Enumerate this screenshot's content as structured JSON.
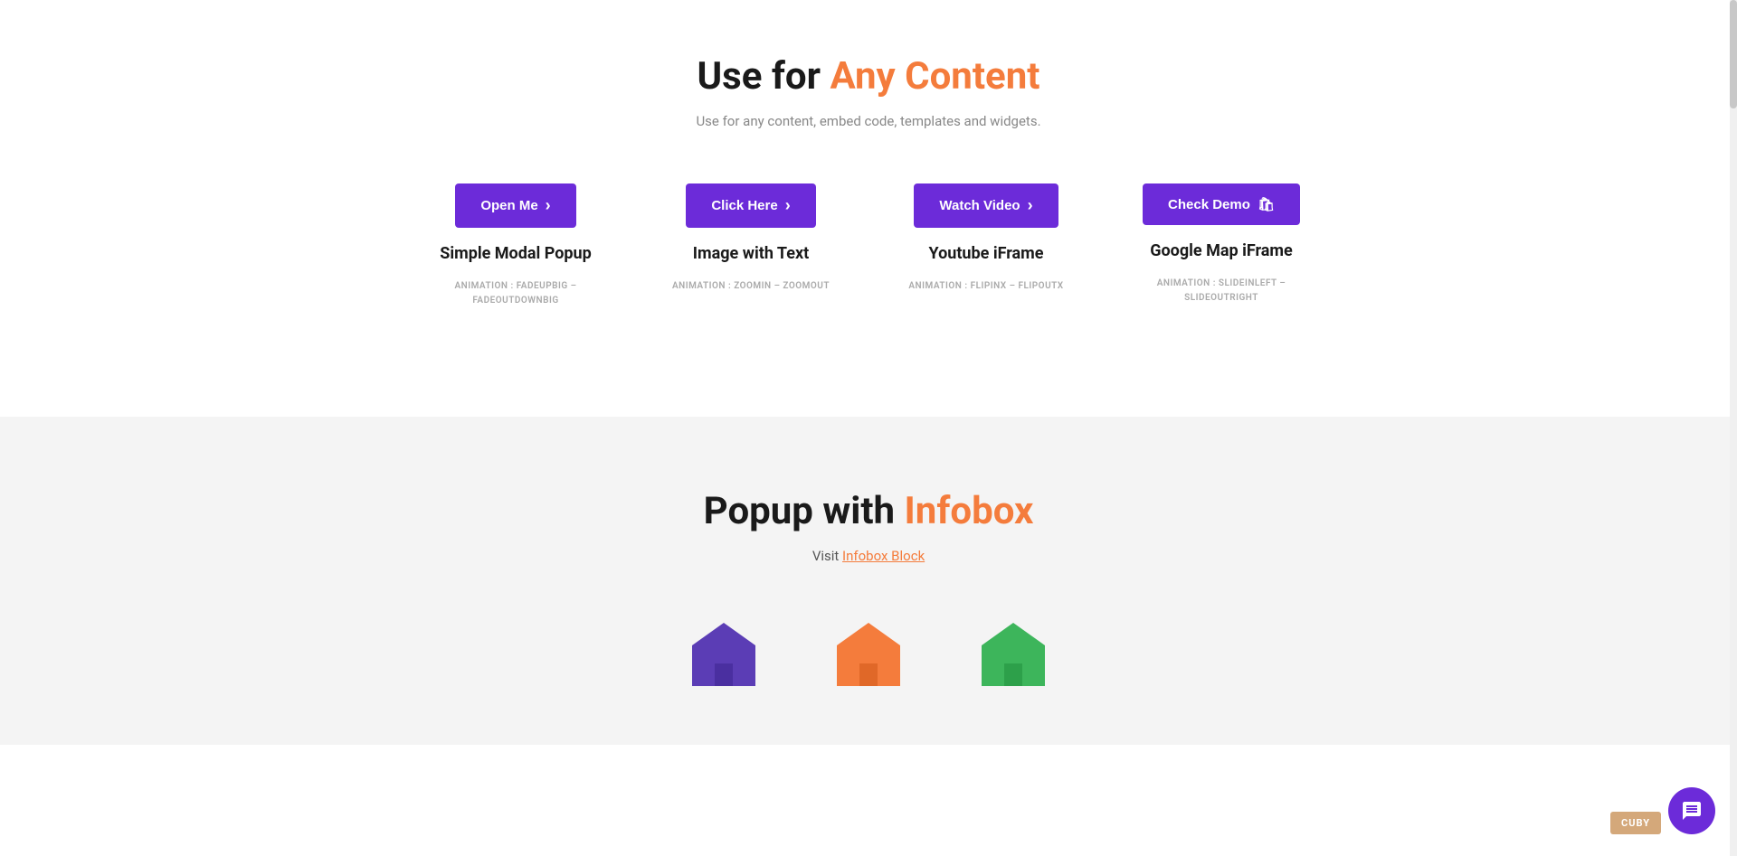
{
  "section1": {
    "title_prefix": "Use for ",
    "title_highlight": "Any Content",
    "subtitle": "Use for any content, embed code, templates and widgets.",
    "cards": [
      {
        "id": "simple-modal",
        "button_label": "Open Me",
        "button_icon": "arrow",
        "title": "Simple Modal Popup",
        "animation_line1": "ANIMATION : FADEUPBIG –",
        "animation_line2": "FADEOUTDOWNBIG"
      },
      {
        "id": "image-with-text",
        "button_label": "Click Here",
        "button_icon": "arrow",
        "title": "Image with Text",
        "animation_line1": "ANIMATION : ZOOMIN – ZOOMOUT",
        "animation_line2": ""
      },
      {
        "id": "youtube-iframe",
        "button_label": "Watch Video",
        "button_icon": "arrow",
        "title": "Youtube iFrame",
        "animation_line1": "ANIMATION : FLIPINX – FLIPOUTX",
        "animation_line2": ""
      },
      {
        "id": "google-map-iframe",
        "button_label": "Check Demo",
        "button_icon": "bag",
        "title": "Google Map iFrame",
        "animation_line1": "ANIMATION : SLIDEINLEFT – SLIDEOUTRIGHT",
        "animation_line2": ""
      }
    ]
  },
  "section2": {
    "title_prefix": "Popup with ",
    "title_highlight": "Infobox",
    "subtitle_prefix": "Visit ",
    "subtitle_link_text": "Infobox Block",
    "subtitle_link_href": "#",
    "icons": [
      {
        "color": "#5b3db5",
        "shape": "house"
      },
      {
        "color": "#f47c3c",
        "shape": "house"
      },
      {
        "color": "#3db55b",
        "shape": "house"
      }
    ]
  },
  "chat_widget": {
    "label": "chat"
  },
  "cuby_badge": {
    "label": "CUBY"
  }
}
